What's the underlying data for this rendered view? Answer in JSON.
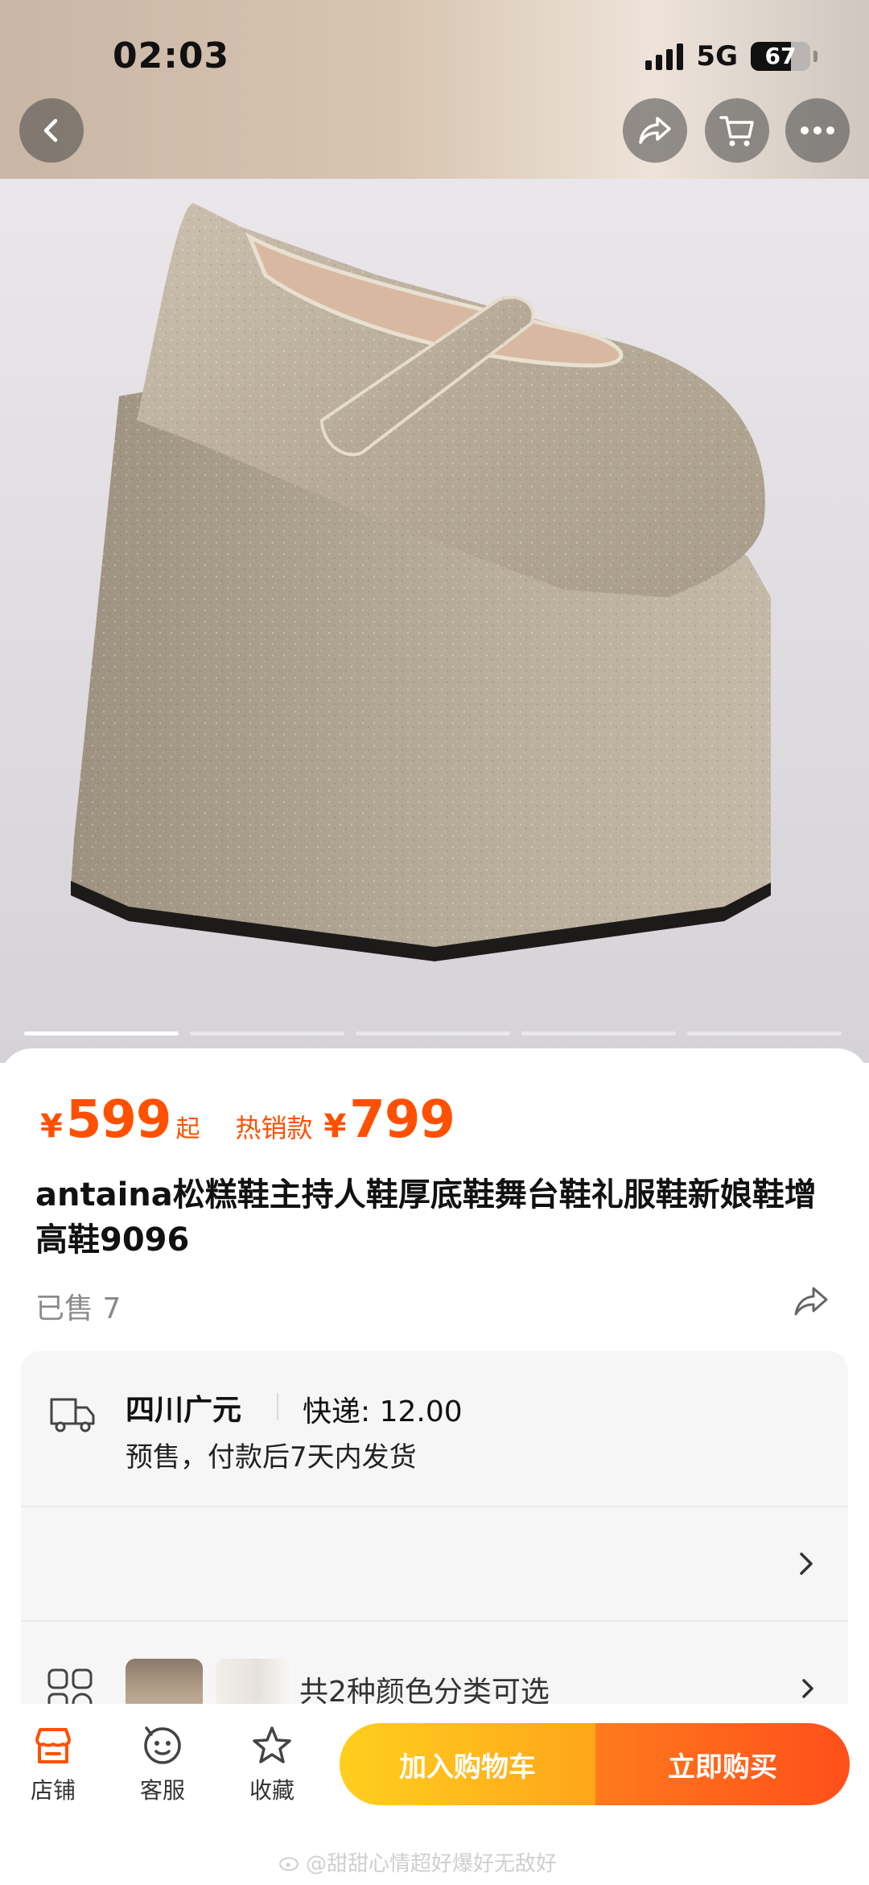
{
  "status_bar": {
    "time": "02:03",
    "network": "5G",
    "battery": "67",
    "battery_level": 0.67
  },
  "nav": {
    "back_icon": "chevron-left-icon",
    "share_icon": "share-icon",
    "cart_icon": "cart-icon",
    "more_icon": "more-icon"
  },
  "carousel": {
    "count": 5,
    "active_index": 0
  },
  "product": {
    "currency": "¥",
    "price": "599",
    "price_suffix": "起",
    "hot_label": "热销款",
    "hot_price": "799",
    "title": "antaina松糕鞋主持人鞋厚底鞋舞台鞋礼服鞋新娘鞋增高鞋9096",
    "sold": "已售 7"
  },
  "shipping": {
    "origin": "四川广元",
    "express": "快递: 12.00",
    "presale_note": "预售，付款后7天内发货"
  },
  "variants": {
    "label": "共2种颜色分类可选"
  },
  "bottom_bar": {
    "shop_label": "店铺",
    "service_label": "客服",
    "favorite_label": "收藏",
    "add_to_cart": "加入购物车",
    "buy_now": "立即购买"
  },
  "watermark": "@甜甜心情超好爆好无敌好",
  "colors": {
    "accent": "#ff5000",
    "cart_button": "#ffb81c",
    "buy_button": "#ff5a1b"
  }
}
